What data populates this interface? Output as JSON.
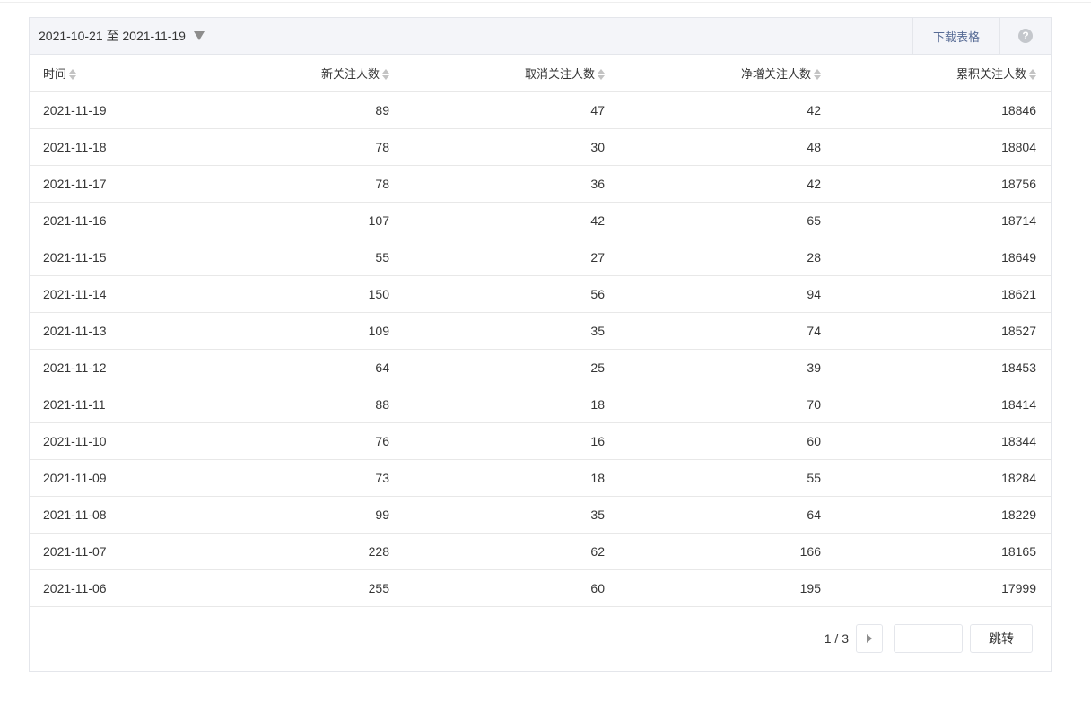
{
  "toolbar": {
    "date_range": "2021-10-21 至 2021-11-19",
    "download_label": "下载表格",
    "help_label": "?"
  },
  "table": {
    "headers": [
      "时间",
      "新关注人数",
      "取消关注人数",
      "净增关注人数",
      "累积关注人数"
    ],
    "rows": [
      [
        "2021-11-19",
        "89",
        "47",
        "42",
        "18846"
      ],
      [
        "2021-11-18",
        "78",
        "30",
        "48",
        "18804"
      ],
      [
        "2021-11-17",
        "78",
        "36",
        "42",
        "18756"
      ],
      [
        "2021-11-16",
        "107",
        "42",
        "65",
        "18714"
      ],
      [
        "2021-11-15",
        "55",
        "27",
        "28",
        "18649"
      ],
      [
        "2021-11-14",
        "150",
        "56",
        "94",
        "18621"
      ],
      [
        "2021-11-13",
        "109",
        "35",
        "74",
        "18527"
      ],
      [
        "2021-11-12",
        "64",
        "25",
        "39",
        "18453"
      ],
      [
        "2021-11-11",
        "88",
        "18",
        "70",
        "18414"
      ],
      [
        "2021-11-10",
        "76",
        "16",
        "60",
        "18344"
      ],
      [
        "2021-11-09",
        "73",
        "18",
        "55",
        "18284"
      ],
      [
        "2021-11-08",
        "99",
        "35",
        "64",
        "18229"
      ],
      [
        "2021-11-07",
        "228",
        "62",
        "166",
        "18165"
      ],
      [
        "2021-11-06",
        "255",
        "60",
        "195",
        "17999"
      ]
    ]
  },
  "pagination": {
    "page_info": "1 / 3",
    "jump_value": "",
    "jump_label": "跳转"
  }
}
